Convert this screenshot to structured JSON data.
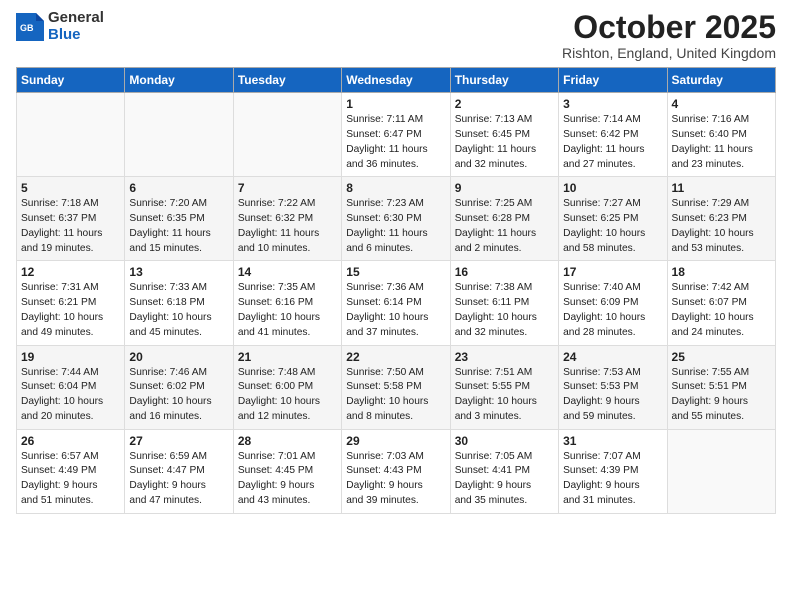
{
  "logo": {
    "general": "General",
    "blue": "Blue"
  },
  "title": "October 2025",
  "location": "Rishton, England, United Kingdom",
  "days_of_week": [
    "Sunday",
    "Monday",
    "Tuesday",
    "Wednesday",
    "Thursday",
    "Friday",
    "Saturday"
  ],
  "weeks": [
    [
      {
        "day": "",
        "info": ""
      },
      {
        "day": "",
        "info": ""
      },
      {
        "day": "",
        "info": ""
      },
      {
        "day": "1",
        "info": "Sunrise: 7:11 AM\nSunset: 6:47 PM\nDaylight: 11 hours\nand 36 minutes."
      },
      {
        "day": "2",
        "info": "Sunrise: 7:13 AM\nSunset: 6:45 PM\nDaylight: 11 hours\nand 32 minutes."
      },
      {
        "day": "3",
        "info": "Sunrise: 7:14 AM\nSunset: 6:42 PM\nDaylight: 11 hours\nand 27 minutes."
      },
      {
        "day": "4",
        "info": "Sunrise: 7:16 AM\nSunset: 6:40 PM\nDaylight: 11 hours\nand 23 minutes."
      }
    ],
    [
      {
        "day": "5",
        "info": "Sunrise: 7:18 AM\nSunset: 6:37 PM\nDaylight: 11 hours\nand 19 minutes."
      },
      {
        "day": "6",
        "info": "Sunrise: 7:20 AM\nSunset: 6:35 PM\nDaylight: 11 hours\nand 15 minutes."
      },
      {
        "day": "7",
        "info": "Sunrise: 7:22 AM\nSunset: 6:32 PM\nDaylight: 11 hours\nand 10 minutes."
      },
      {
        "day": "8",
        "info": "Sunrise: 7:23 AM\nSunset: 6:30 PM\nDaylight: 11 hours\nand 6 minutes."
      },
      {
        "day": "9",
        "info": "Sunrise: 7:25 AM\nSunset: 6:28 PM\nDaylight: 11 hours\nand 2 minutes."
      },
      {
        "day": "10",
        "info": "Sunrise: 7:27 AM\nSunset: 6:25 PM\nDaylight: 10 hours\nand 58 minutes."
      },
      {
        "day": "11",
        "info": "Sunrise: 7:29 AM\nSunset: 6:23 PM\nDaylight: 10 hours\nand 53 minutes."
      }
    ],
    [
      {
        "day": "12",
        "info": "Sunrise: 7:31 AM\nSunset: 6:21 PM\nDaylight: 10 hours\nand 49 minutes."
      },
      {
        "day": "13",
        "info": "Sunrise: 7:33 AM\nSunset: 6:18 PM\nDaylight: 10 hours\nand 45 minutes."
      },
      {
        "day": "14",
        "info": "Sunrise: 7:35 AM\nSunset: 6:16 PM\nDaylight: 10 hours\nand 41 minutes."
      },
      {
        "day": "15",
        "info": "Sunrise: 7:36 AM\nSunset: 6:14 PM\nDaylight: 10 hours\nand 37 minutes."
      },
      {
        "day": "16",
        "info": "Sunrise: 7:38 AM\nSunset: 6:11 PM\nDaylight: 10 hours\nand 32 minutes."
      },
      {
        "day": "17",
        "info": "Sunrise: 7:40 AM\nSunset: 6:09 PM\nDaylight: 10 hours\nand 28 minutes."
      },
      {
        "day": "18",
        "info": "Sunrise: 7:42 AM\nSunset: 6:07 PM\nDaylight: 10 hours\nand 24 minutes."
      }
    ],
    [
      {
        "day": "19",
        "info": "Sunrise: 7:44 AM\nSunset: 6:04 PM\nDaylight: 10 hours\nand 20 minutes."
      },
      {
        "day": "20",
        "info": "Sunrise: 7:46 AM\nSunset: 6:02 PM\nDaylight: 10 hours\nand 16 minutes."
      },
      {
        "day": "21",
        "info": "Sunrise: 7:48 AM\nSunset: 6:00 PM\nDaylight: 10 hours\nand 12 minutes."
      },
      {
        "day": "22",
        "info": "Sunrise: 7:50 AM\nSunset: 5:58 PM\nDaylight: 10 hours\nand 8 minutes."
      },
      {
        "day": "23",
        "info": "Sunrise: 7:51 AM\nSunset: 5:55 PM\nDaylight: 10 hours\nand 3 minutes."
      },
      {
        "day": "24",
        "info": "Sunrise: 7:53 AM\nSunset: 5:53 PM\nDaylight: 9 hours\nand 59 minutes."
      },
      {
        "day": "25",
        "info": "Sunrise: 7:55 AM\nSunset: 5:51 PM\nDaylight: 9 hours\nand 55 minutes."
      }
    ],
    [
      {
        "day": "26",
        "info": "Sunrise: 6:57 AM\nSunset: 4:49 PM\nDaylight: 9 hours\nand 51 minutes."
      },
      {
        "day": "27",
        "info": "Sunrise: 6:59 AM\nSunset: 4:47 PM\nDaylight: 9 hours\nand 47 minutes."
      },
      {
        "day": "28",
        "info": "Sunrise: 7:01 AM\nSunset: 4:45 PM\nDaylight: 9 hours\nand 43 minutes."
      },
      {
        "day": "29",
        "info": "Sunrise: 7:03 AM\nSunset: 4:43 PM\nDaylight: 9 hours\nand 39 minutes."
      },
      {
        "day": "30",
        "info": "Sunrise: 7:05 AM\nSunset: 4:41 PM\nDaylight: 9 hours\nand 35 minutes."
      },
      {
        "day": "31",
        "info": "Sunrise: 7:07 AM\nSunset: 4:39 PM\nDaylight: 9 hours\nand 31 minutes."
      },
      {
        "day": "",
        "info": ""
      }
    ]
  ]
}
